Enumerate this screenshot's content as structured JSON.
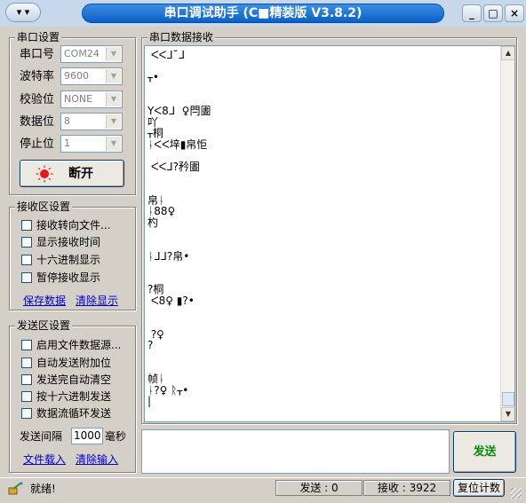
{
  "window": {
    "title": "串口调试助手 (C■精装版 V3.8.2)",
    "sysmenu": "▾ ▾",
    "buttons": {
      "minimize": "_",
      "maximize": "□",
      "close": "×"
    }
  },
  "serial_settings": {
    "legend": "串口设置",
    "fields": [
      {
        "label": "串口号",
        "value": "COM24"
      },
      {
        "label": "波特率",
        "value": "9600"
      },
      {
        "label": "校验位",
        "value": "NONE"
      },
      {
        "label": "数据位",
        "value": "8"
      },
      {
        "label": "停止位",
        "value": "1"
      }
    ],
    "toggle_button": "断开",
    "status_color": "#e8171a"
  },
  "receive_settings": {
    "legend": "接收区设置",
    "options": [
      "接收转向文件...",
      "显示接收时间",
      "十六进制显示",
      "暂停接收显示"
    ],
    "links": {
      "save": "保存数据",
      "clear": "清除显示"
    }
  },
  "send_settings": {
    "legend": "发送区设置",
    "options": [
      "启用文件数据源...",
      "自动发送附加位",
      "发送完自动清空",
      "按十六进制发送",
      "数据流循环发送"
    ],
    "interval_label": "发送间隔",
    "interval_value": "1000",
    "interval_unit": "毫秒",
    "links": {
      "load": "文件载入",
      "clear": "清除输入"
    }
  },
  "receive_area": {
    "legend": "串口数据接收",
    "lines": [
      " ᐸᐸᒧ˘ᒧ",
      "",
      "ᚁ•",
      "",
      "",
      "Yᐸ8ᒧ  ♀閂圕",
      "吖",
      "ᚁ桐",
      "ᚿᐸᐸ垶▮帛怇",
      "",
      " ᐸᐸᒧ?矜圕",
      "",
      "",
      "帛ᚿ",
      "ᚿ88♀",
      "杓",
      "",
      "",
      "ᚿᒧᒧ?帛•",
      "",
      "",
      "?桐",
      " ᐸ8♀ ▮?•",
      "",
      "",
      " ?♀",
      "?",
      "",
      "",
      "帧ᚿ",
      "ᚿ?♀ ᚱᚁ•",
      "|"
    ]
  },
  "send_area": {
    "value": "",
    "send_button": "发送"
  },
  "statusbar": {
    "ready": "就绪!",
    "sent": "发送 : 0",
    "received": "接收 : 3922",
    "reset_button": "复位计数"
  }
}
